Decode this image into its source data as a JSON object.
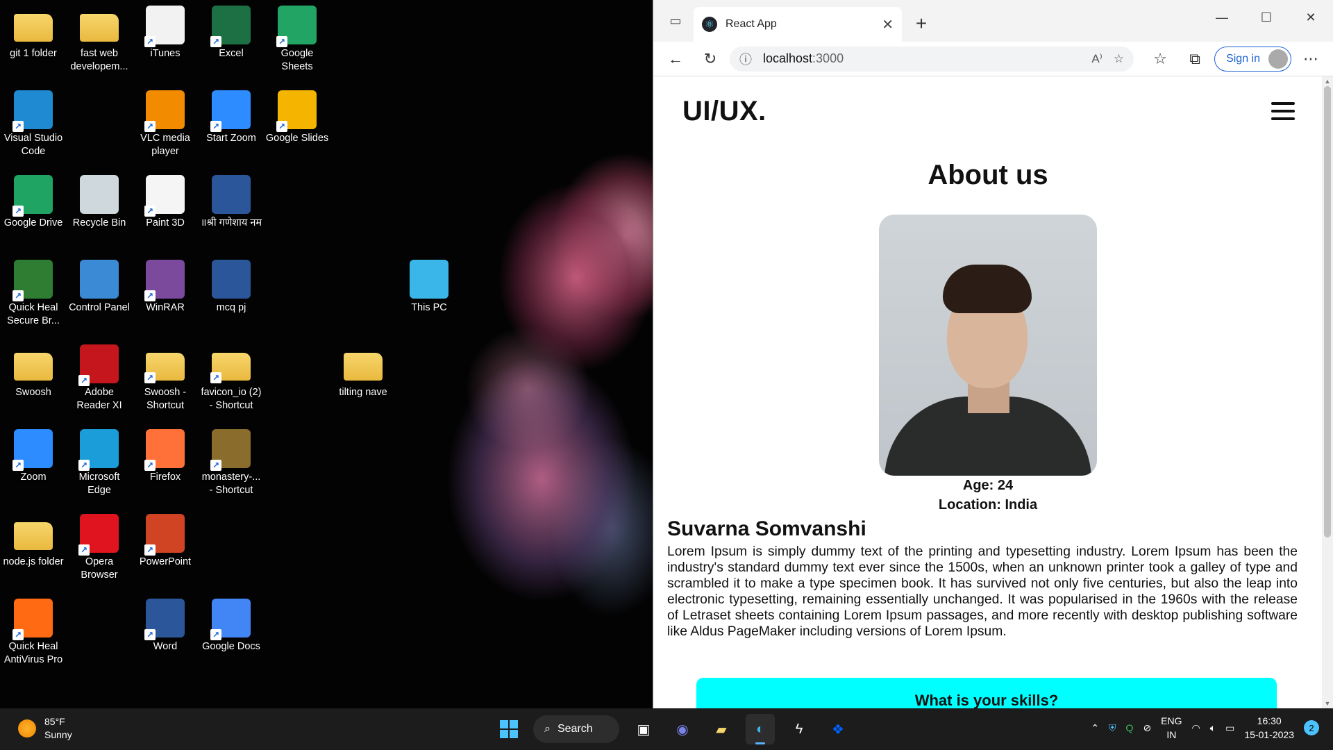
{
  "desktop": {
    "icons": [
      {
        "label": "git 1 folder",
        "icon": "folder-icon",
        "color": "#e9b93f",
        "folder": true,
        "shortcut": false
      },
      {
        "label": "fast web developem...",
        "icon": "folder-icon",
        "color": "#e9b93f",
        "folder": true,
        "shortcut": false
      },
      {
        "label": "iTunes",
        "icon": "itunes-icon",
        "color": "#f2f2f2",
        "folder": false,
        "shortcut": true
      },
      {
        "label": "Excel",
        "icon": "excel-icon",
        "color": "#1d7044",
        "folder": false,
        "shortcut": true
      },
      {
        "label": "Google Sheets",
        "icon": "google-sheets-icon",
        "color": "#21a464",
        "folder": false,
        "shortcut": true
      },
      {
        "label": "Visual Studio Code",
        "icon": "vscode-icon",
        "color": "#1f8ad2",
        "folder": false,
        "shortcut": true
      },
      {
        "label": "VLC media player",
        "icon": "vlc-icon",
        "color": "#f28b00",
        "folder": false,
        "shortcut": true
      },
      {
        "label": "Start Zoom",
        "icon": "zoom-icon",
        "color": "#2d8cff",
        "folder": false,
        "shortcut": true
      },
      {
        "label": "Google Slides",
        "icon": "google-slides-icon",
        "color": "#f4b400",
        "folder": false,
        "shortcut": true
      },
      {
        "label": "Google Drive",
        "icon": "google-drive-icon",
        "color": "#1fa463",
        "folder": false,
        "shortcut": true
      },
      {
        "label": "Recycle Bin",
        "icon": "recycle-bin-icon",
        "color": "#cfd8dc",
        "folder": false,
        "shortcut": false
      },
      {
        "label": "Paint 3D",
        "icon": "paint3d-icon",
        "color": "#f5f5f5",
        "folder": false,
        "shortcut": true
      },
      {
        "label": "॥श्री गणेशाय नम",
        "icon": "word-document-icon",
        "color": "#2b579a",
        "folder": false,
        "shortcut": false
      },
      {
        "label": "Quick Heal Secure Br...",
        "icon": "quickheal-browser-icon",
        "color": "#2e7d32",
        "folder": false,
        "shortcut": true
      },
      {
        "label": "Control Panel",
        "icon": "control-panel-icon",
        "color": "#3a8ad6",
        "folder": false,
        "shortcut": false
      },
      {
        "label": "WinRAR",
        "icon": "winrar-icon",
        "color": "#7b4a9c",
        "folder": false,
        "shortcut": true
      },
      {
        "label": "mcq pj",
        "icon": "word-document-icon",
        "color": "#2b579a",
        "folder": false,
        "shortcut": false
      },
      {
        "label": "This PC",
        "icon": "this-pc-icon",
        "color": "#3ab6e8",
        "folder": false,
        "shortcut": false
      },
      {
        "label": "Swoosh",
        "icon": "folder-icon",
        "color": "#e9b93f",
        "folder": true,
        "shortcut": false
      },
      {
        "label": "Adobe Reader XI",
        "icon": "adobe-reader-icon",
        "color": "#c4161c",
        "folder": false,
        "shortcut": true
      },
      {
        "label": "Swoosh - Shortcut",
        "icon": "folder-icon",
        "color": "#e9b93f",
        "folder": true,
        "shortcut": true
      },
      {
        "label": "favicon_io (2) - Shortcut",
        "icon": "zip-folder-icon",
        "color": "#e9b93f",
        "folder": true,
        "shortcut": true
      },
      {
        "label": "tilting nave",
        "icon": "folder-icon",
        "color": "#e9b93f",
        "folder": true,
        "shortcut": false
      },
      {
        "label": "Zoom",
        "icon": "zoom-icon",
        "color": "#2d8cff",
        "folder": false,
        "shortcut": true
      },
      {
        "label": "Microsoft Edge",
        "icon": "edge-icon",
        "color": "#1a9dd8",
        "folder": false,
        "shortcut": true
      },
      {
        "label": "Firefox",
        "icon": "firefox-icon",
        "color": "#ff7139",
        "folder": false,
        "shortcut": true
      },
      {
        "label": "monastery-... - Shortcut",
        "icon": "image-file-icon",
        "color": "#8a6d2c",
        "folder": false,
        "shortcut": true
      },
      {
        "label": "node.js folder",
        "icon": "folder-icon",
        "color": "#e9b93f",
        "folder": true,
        "shortcut": false
      },
      {
        "label": "Opera Browser",
        "icon": "opera-icon",
        "color": "#e0141e",
        "folder": false,
        "shortcut": true
      },
      {
        "label": "PowerPoint",
        "icon": "powerpoint-icon",
        "color": "#d04423",
        "folder": false,
        "shortcut": true
      },
      {
        "label": "Quick Heal AntiVirus Pro",
        "icon": "quickheal-antivirus-icon",
        "color": "#ff6a13",
        "folder": false,
        "shortcut": true
      },
      {
        "label": "Word",
        "icon": "word-icon",
        "color": "#2b579a",
        "folder": false,
        "shortcut": true
      },
      {
        "label": "Google Docs",
        "icon": "google-docs-icon",
        "color": "#4285f4",
        "folder": false,
        "shortcut": true
      }
    ]
  },
  "browser": {
    "tab_title": "React App",
    "url_host": "localhost",
    "url_port": ":3000",
    "sign_in_label": "Sign in",
    "accent_color": "#1a62d1"
  },
  "page": {
    "logo": "UI/UX.",
    "heading": "About us",
    "age": "Age: 24",
    "location": "Location: India",
    "name": "Suvarna Somvanshi",
    "bio": "Lorem Ipsum is simply dummy text of the printing and typesetting industry. Lorem Ipsum has been the industry's standard dummy text ever since the 1500s, when an unknown printer took a galley of type and scrambled it to make a type specimen book. It has survived not only five centuries, but also the leap into electronic typesetting, remaining essentially unchanged. It was popularised in the 1960s with the release of Letraset sheets containing Lorem Ipsum passages, and more recently with desktop publishing software like Aldus PageMaker including versions of Lorem Ipsum.",
    "skills_heading": "What is your skills?",
    "skills_color": "#00ffff"
  },
  "taskbar": {
    "weather_temp": "85°F",
    "weather_desc": "Sunny",
    "search_label": "Search",
    "lang_top": "ENG",
    "lang_bottom": "IN",
    "time": "16:30",
    "date": "15-01-2023",
    "notification_count": "2"
  }
}
